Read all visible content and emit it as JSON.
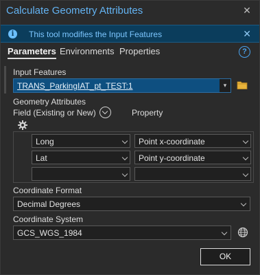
{
  "window": {
    "title": "Calculate Geometry Attributes",
    "close_label": "✕"
  },
  "banner": {
    "icon": "info-icon",
    "icon_glyph": "i",
    "text": "This tool modifies the Input Features",
    "close_label": "✕"
  },
  "tabs": [
    {
      "label": "Parameters",
      "active": true
    },
    {
      "label": "Environments",
      "active": false
    },
    {
      "label": "Properties",
      "active": false
    }
  ],
  "help": {
    "glyph": "?"
  },
  "input_features": {
    "label": "Input Features",
    "value": "TRANS_ParkingIAT_pt_TEST:1",
    "dropdown_glyph": "▾"
  },
  "geometry_attributes": {
    "label": "Geometry Attributes",
    "field_header": "Field (Existing or New)",
    "property_header": "Property",
    "rows": [
      {
        "field": "Long",
        "property": "Point x-coordinate"
      },
      {
        "field": "Lat",
        "property": "Point y-coordinate"
      },
      {
        "field": "",
        "property": ""
      }
    ]
  },
  "coordinate_format": {
    "label": "Coordinate Format",
    "value": "Decimal Degrees"
  },
  "coordinate_system": {
    "label": "Coordinate System",
    "value": "GCS_WGS_1984"
  },
  "ok_button": {
    "label": "OK"
  },
  "colors": {
    "accent": "#63b3f2",
    "banner_bg": "#0b3d5c",
    "selected_input_bg": "#0e4f80"
  }
}
